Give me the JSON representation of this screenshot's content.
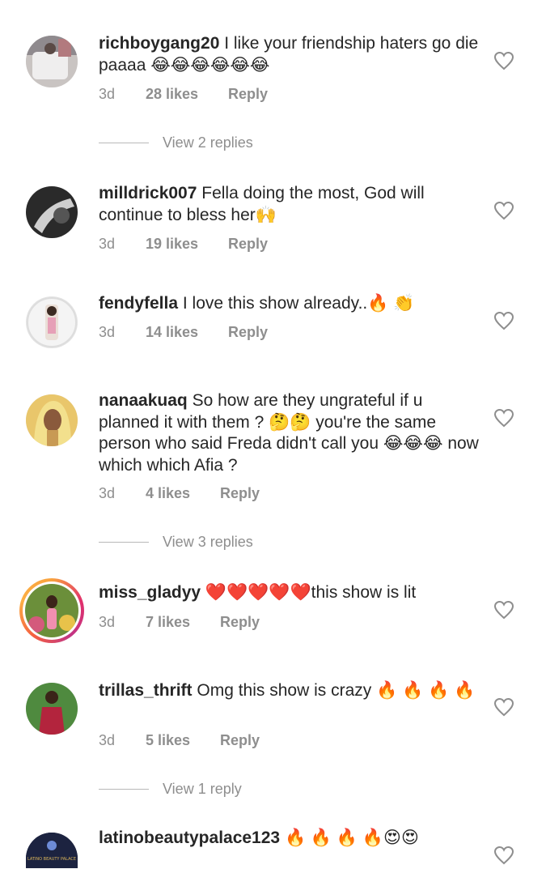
{
  "comments": [
    {
      "username": "richboygang20",
      "text": "I like your friendship haters go die paaaa 😂😂😂😂😂😂",
      "time": "3d",
      "likes": "28 likes",
      "reply": "Reply",
      "view_replies": "View 2 replies"
    },
    {
      "username": "milldrick007",
      "text": "Fella doing the most, God will continue to bless her🙌",
      "time": "3d",
      "likes": "19 likes",
      "reply": "Reply"
    },
    {
      "username": "fendyfella",
      "text": "I love this show already..🔥 👏",
      "time": "3d",
      "likes": "14 likes",
      "reply": "Reply"
    },
    {
      "username": "nanaakuaq",
      "text": "So how are they ungrateful if u planned it with them ? 🤔🤔 you're the same person who said Freda didn't call you 😂😂😂 now which which Afia ?",
      "time": "3d",
      "likes": "4 likes",
      "reply": "Reply",
      "view_replies": "View 3 replies"
    },
    {
      "username": "miss_gladyy",
      "text": "❤️❤️❤️❤️❤️this show is lit",
      "time": "3d",
      "likes": "7 likes",
      "reply": "Reply"
    },
    {
      "username": "trillas_thrift",
      "text": "Omg this show is crazy 🔥 🔥 🔥 🔥",
      "time": "3d",
      "likes": "5 likes",
      "reply": "Reply",
      "view_replies": "View 1 reply"
    },
    {
      "username": "latinobeautypalace123",
      "text": "🔥 🔥 🔥 🔥😍😍"
    }
  ],
  "avatar_badge_text": "LATINO BEAUTY PALACE",
  "icons": {
    "like": "heart-outline-icon"
  },
  "colors": {
    "text": "#262626",
    "meta": "#8e8e8e",
    "story_ring": "#e1306c"
  }
}
